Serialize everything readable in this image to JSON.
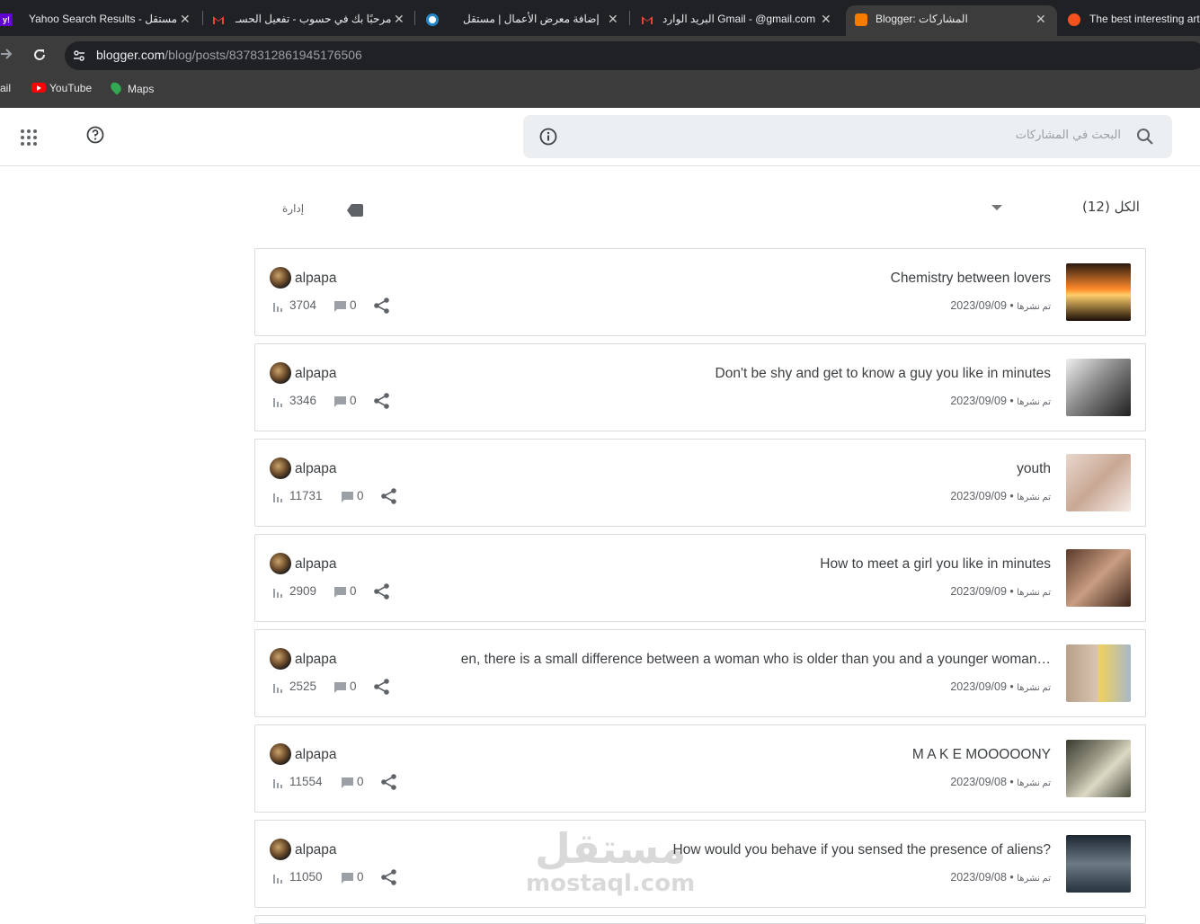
{
  "tabs": [
    {
      "title": "Yahoo Search Results - مستقل",
      "favicon": "yahoo-icon",
      "active": false
    },
    {
      "title": "مرحبًا بك في حسوب - تفعيل الحسـ",
      "favicon": "gmail-icon",
      "active": false
    },
    {
      "title": "إضافة معرض الأعمال | مستقل",
      "favicon": "mostaql-icon",
      "active": false
    },
    {
      "title": "البريد الوارد Gmail - @gmail.com",
      "favicon": "gmail-icon",
      "active": false
    },
    {
      "title": "Blogger: المشاركات",
      "favicon": "blogger-icon",
      "active": true
    },
    {
      "title": "The best interesting art",
      "favicon": "blogger-icon",
      "active": false
    }
  ],
  "address": {
    "domain": "blogger.com",
    "path": "/blog/posts/8378312861945176506"
  },
  "bookmarks": [
    {
      "label": "ail",
      "icon": "gmail-icon"
    },
    {
      "label": "YouTube",
      "icon": "youtube-icon"
    },
    {
      "label": "Maps",
      "icon": "maps-icon"
    }
  ],
  "header": {
    "search_placeholder": "البحث في المشاركات"
  },
  "filter": {
    "label": "الكل (12)",
    "manage_label": "إدارة"
  },
  "posts": [
    {
      "title": "Chemistry between lovers",
      "status": "تم نشرها",
      "date": "2023/09/09",
      "author": "alpapa",
      "views": "3704",
      "comments": "0",
      "thumb": "heart-hands"
    },
    {
      "title": "Don't be shy and get to know a guy you like in minutes",
      "status": "تم نشرها",
      "date": "2023/09/09",
      "author": "alpapa",
      "views": "3346",
      "comments": "0",
      "thumb": "man-bw"
    },
    {
      "title": "youth",
      "status": "تم نشرها",
      "date": "2023/09/09",
      "author": "alpapa",
      "views": "11731",
      "comments": "0",
      "thumb": "older-woman"
    },
    {
      "title": "How to meet a girl you like in minutes",
      "status": "تم نشرها",
      "date": "2023/09/09",
      "author": "alpapa",
      "views": "2909",
      "comments": "0",
      "thumb": "young-woman"
    },
    {
      "title": "en, there is a small difference between a woman who is older than you and a younger woman…",
      "status": "تم نشرها",
      "date": "2023/09/09",
      "author": "alpapa",
      "views": "2525",
      "comments": "0",
      "thumb": "two-women"
    },
    {
      "title": "M A K E MOOOOONY",
      "status": "تم نشرها",
      "date": "2023/09/08",
      "author": "alpapa",
      "views": "11554",
      "comments": "0",
      "thumb": "money"
    },
    {
      "title": "How would you behave if you sensed the presence of aliens?",
      "status": "تم نشرها",
      "date": "2023/09/08",
      "author": "alpapa",
      "views": "11050",
      "comments": "0",
      "thumb": "aliens"
    }
  ],
  "watermark": {
    "arabic": "مستقل",
    "latin": "mostaql.com"
  }
}
